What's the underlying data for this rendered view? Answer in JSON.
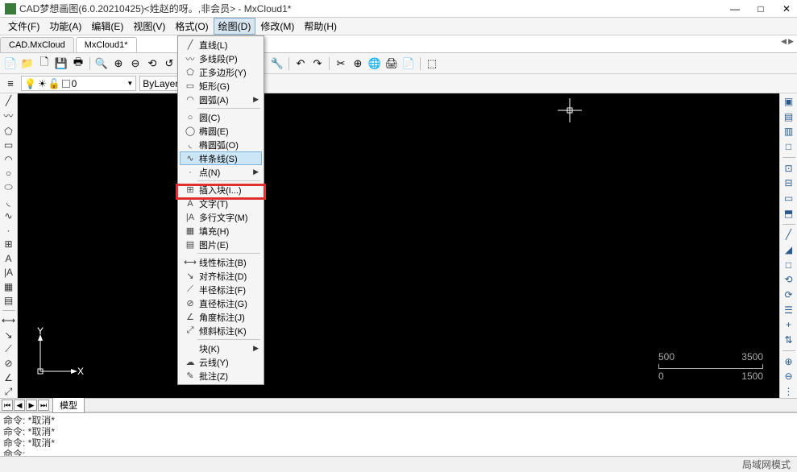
{
  "window": {
    "title": "CAD梦想画图(6.0.20210425)<姓赵的呀。,非会员> - MxCloud1*",
    "min": "—",
    "max": "□",
    "close": "✕"
  },
  "menus": [
    "文件(F)",
    "功能(A)",
    "编辑(E)",
    "视图(V)",
    "格式(O)",
    "绘图(D)",
    "修改(M)",
    "帮助(H)"
  ],
  "open_menu_index": 5,
  "tabs": {
    "items": [
      "CAD.MxCloud",
      "MxCloud1*"
    ],
    "active": 1
  },
  "layer": {
    "current": "0",
    "bylayer": "ByLayer"
  },
  "dropdown": [
    {
      "icon": "╱",
      "label": "直线(L)"
    },
    {
      "icon": "〰",
      "label": "多线段(P)"
    },
    {
      "icon": "⬠",
      "label": "正多边形(Y)"
    },
    {
      "icon": "▭",
      "label": "矩形(G)"
    },
    {
      "icon": "◠",
      "label": "圆弧(A)",
      "sub": true
    },
    {
      "sep": true
    },
    {
      "icon": "○",
      "label": "圆(C)"
    },
    {
      "icon": "◯",
      "label": "椭圆(E)"
    },
    {
      "icon": "◟",
      "label": "椭圆弧(O)"
    },
    {
      "icon": "∿",
      "label": "样条线(S)",
      "highlight": true
    },
    {
      "icon": "·",
      "label": "点(N)",
      "sub": true
    },
    {
      "sep": true
    },
    {
      "icon": "⊞",
      "label": "插入块(I...)"
    },
    {
      "icon": "A",
      "label": "文字(T)"
    },
    {
      "icon": "|A",
      "label": "多行文字(M)"
    },
    {
      "icon": "▦",
      "label": "填充(H)"
    },
    {
      "icon": "▤",
      "label": "图片(E)"
    },
    {
      "sep": true
    },
    {
      "icon": "⟷",
      "label": "线性标注(B)"
    },
    {
      "icon": "↘",
      "label": "对齐标注(D)"
    },
    {
      "icon": "⟋",
      "label": "半径标注(F)"
    },
    {
      "icon": "⊘",
      "label": "直径标注(G)"
    },
    {
      "icon": "∠",
      "label": "角度标注(J)"
    },
    {
      "icon": "⤢",
      "label": "倾斜标注(K)"
    },
    {
      "sep": true
    },
    {
      "icon": "",
      "label": "块(K)",
      "sub": true
    },
    {
      "icon": "☁",
      "label": "云线(Y)"
    },
    {
      "icon": "✎",
      "label": "批注(Z)"
    }
  ],
  "left_tools": [
    "╱",
    "〰",
    "⬠",
    "▭",
    "◠",
    "○",
    "⬭",
    "◟",
    "∿",
    "·",
    "⊞",
    "A",
    "|A",
    "▦",
    "▤",
    "—",
    "⟷",
    "↘",
    "⟋",
    "⊘",
    "∠",
    "⤢"
  ],
  "right_tools": [
    "▣",
    "▤",
    "▥",
    "□",
    "—",
    "⊡",
    "⊟",
    "▭",
    "⬒",
    "—",
    "╱",
    "◢",
    "□",
    "⟲",
    "⟳",
    "☰",
    "+",
    "⇅",
    "—",
    "⊕",
    "⊖",
    "⋮"
  ],
  "toolbar1_left": [
    "📄",
    "📁",
    "🗋",
    "💾",
    "🖶",
    "|",
    "🔍",
    "⊕",
    "⊖",
    "⟲",
    "↺",
    "⬚",
    "🔎"
  ],
  "toolbar1_right": [
    "|",
    "🖉",
    "⇄",
    "⬚",
    "🔧",
    "|",
    "↶",
    "↷",
    "|",
    "✂",
    "⊕",
    "🌐",
    "🖨",
    "📄",
    "|",
    "⬚"
  ],
  "ucs": {
    "x": "X",
    "y": "Y"
  },
  "scale": {
    "t1": "500",
    "t2": "3500",
    "b1": "0",
    "b2": "1500"
  },
  "bottom_tabs": {
    "nav": [
      "⏮",
      "◀",
      "▶",
      "⏭"
    ],
    "label": "模型"
  },
  "cmd": {
    "lines": [
      "命令: *取消*",
      "命令: *取消*",
      "命令: *取消*"
    ],
    "prompt": "命令:"
  },
  "status": {
    "left": "",
    "coords": "",
    "right": "局域网模式"
  }
}
